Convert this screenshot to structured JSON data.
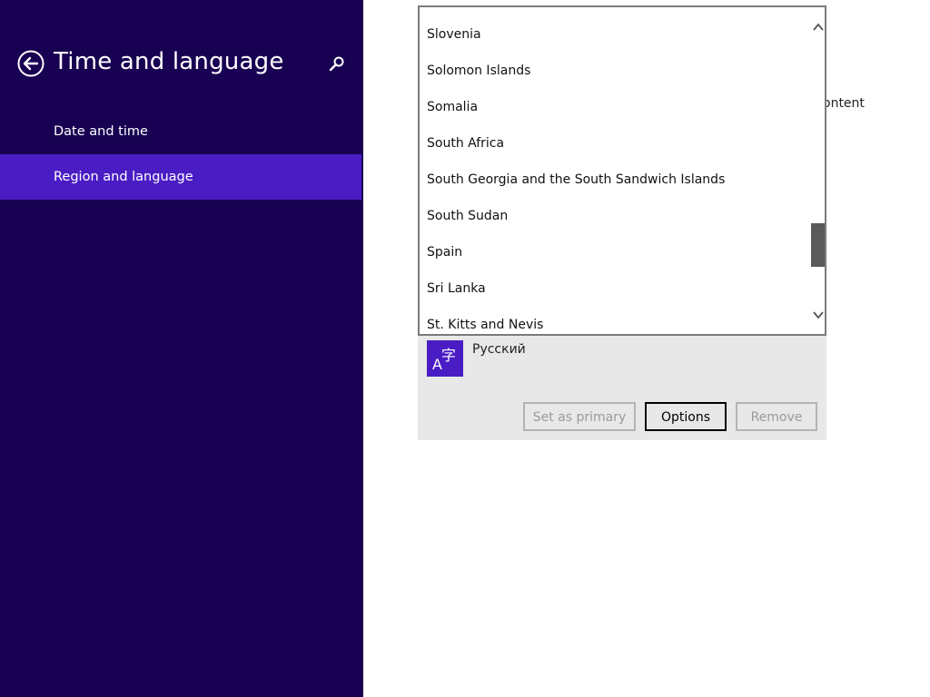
{
  "sidebar": {
    "title": "Time and language",
    "items": [
      {
        "label": "Date and time",
        "selected": false
      },
      {
        "label": "Region and language",
        "selected": true
      }
    ],
    "icons": {
      "back": "back-arrow-icon",
      "search": "search-icon"
    }
  },
  "main": {
    "partial_text": "ontent",
    "dropdown": {
      "items": [
        "Slovenia",
        "Solomon Islands",
        "Somalia",
        "South Africa",
        "South Georgia and the South Sandwich Islands",
        "South Sudan",
        "Spain",
        "Sri Lanka",
        "St. Kitts and Nevis"
      ],
      "scroll_position": 0.65
    },
    "language": {
      "name": "Русский",
      "icon": "language-icon",
      "buttons": {
        "set_primary": "Set as primary",
        "options": "Options",
        "remove": "Remove"
      }
    }
  },
  "colors": {
    "sidebar_bg": "#180052",
    "accent": "#4a1cc4"
  }
}
